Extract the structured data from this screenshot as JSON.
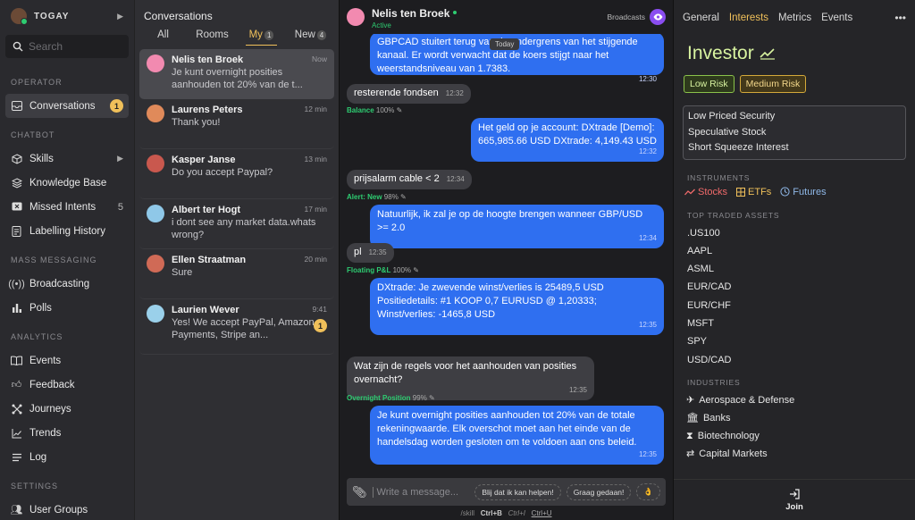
{
  "sidebar": {
    "brand": "TOGAY",
    "search_placeholder": "Search",
    "sections": {
      "operator": "OPERATOR",
      "chatbot": "CHATBOT",
      "mass": "MASS MESSAGING",
      "analytics": "ANALYTICS",
      "settings": "SETTINGS"
    },
    "items": {
      "conversations": {
        "label": "Conversations",
        "badge": "1"
      },
      "skills": {
        "label": "Skills"
      },
      "knowledge": {
        "label": "Knowledge Base"
      },
      "missed": {
        "label": "Missed Intents",
        "count": "5"
      },
      "labelling": {
        "label": "Labelling History"
      },
      "broadcasting": {
        "label": "Broadcasting"
      },
      "polls": {
        "label": "Polls"
      },
      "events": {
        "label": "Events"
      },
      "feedback": {
        "label": "Feedback"
      },
      "journeys": {
        "label": "Journeys"
      },
      "trends": {
        "label": "Trends"
      },
      "log": {
        "label": "Log"
      },
      "usergroups": {
        "label": "User Groups"
      }
    }
  },
  "conversations": {
    "title": "Conversations",
    "tabs": [
      {
        "label": "All"
      },
      {
        "label": "Rooms"
      },
      {
        "label": "My",
        "count": "1"
      },
      {
        "label": "New",
        "count": "4"
      }
    ],
    "list": [
      {
        "name": "Nelis ten Broek",
        "msg": "Je kunt overnight posities aanhouden tot 20% van de t...",
        "time": "Now"
      },
      {
        "name": "Laurens Peters",
        "msg": "Thank you!",
        "time": "12 min"
      },
      {
        "name": "Kasper Janse",
        "msg": "Do you accept Paypal?",
        "time": "13 min"
      },
      {
        "name": "Albert ter Hogt",
        "msg": "i dont see any market data.whats wrong?",
        "time": "17 min"
      },
      {
        "name": "Ellen Straatman",
        "msg": "Sure",
        "time": "20 min"
      },
      {
        "name": "Laurien Wever",
        "msg": "Yes! We accept PayPal, Amazon Payments, Stripe an...",
        "time": "9:41",
        "unread": "1"
      }
    ]
  },
  "chat": {
    "name": "Nelis ten Broek",
    "status": "Active",
    "broadcasts_label": "Broadcasts",
    "today": "Today",
    "messages": [
      {
        "text": "GBPCAD stuitert terug van de ondergrens van het stijgende kanaal. Er wordt verwacht dat de koers stijgt naar het weerstandsniveau van 1.7383.",
        "time": "12:30"
      },
      {
        "text": "resterende fondsen",
        "time": "12:32",
        "label": "Balance",
        "conf": "100%"
      },
      {
        "text": "Het geld op je account: DXtrade [Demo]: 665,985.66 USD DXtrade: 4,149.43 USD",
        "time": "12:32"
      },
      {
        "text": "prijsalarm cable < 2",
        "time": "12:34",
        "label": "Alert: New",
        "conf": "98%"
      },
      {
        "text": "Natuurlijk, ik zal je op de hoogte brengen wanneer GBP/USD >= 2.0",
        "time": "12:34"
      },
      {
        "text": "pl",
        "time": "12:35",
        "label": "Floating P&L",
        "conf": "100%"
      },
      {
        "text": "DXtrade: Je zwevende winst/verlies is 25489,5 USD Positiedetails: #1 KOOP 0,7 EURUSD @ 1,20333; Winst/verlies: -1465,8 USD",
        "time": "12:35"
      },
      {
        "text": "Wat zijn de regels voor het aanhouden van posities overnacht?",
        "time": "12:35",
        "label": "Overnight Position",
        "conf": "99%"
      },
      {
        "text": "Je kunt overnight posities aanhouden tot 20% van de totale rekeningwaarde. Elk overschot moet aan het einde van de handelsdag worden gesloten om te voldoen aan ons beleid.",
        "time": "12:35"
      }
    ],
    "composer": {
      "placeholder": "Write a message...",
      "chip1": "Blij dat ik kan helpen!",
      "chip2": "Graag gedaan!",
      "chip3": "👌"
    },
    "hints": {
      "skill": "/skill",
      "k1": "Ctrl+B",
      "k2": "Ctrl+I",
      "k3": "Ctrl+U"
    }
  },
  "panel": {
    "tabs": [
      "General",
      "Interests",
      "Metrics",
      "Events"
    ],
    "more": "•••",
    "profile": "Investor",
    "risks": [
      "Low Risk",
      "Medium Risk"
    ],
    "tags": [
      "Low Priced Security",
      "Speculative Stock",
      "Short Squeeze Interest"
    ],
    "instruments_title": "INSTRUMENTS",
    "instruments": [
      "Stocks",
      "ETFs",
      "Futures"
    ],
    "assets_title": "TOP TRADED ASSETS",
    "assets": [
      ".US100",
      "AAPL",
      "ASML",
      "EUR/CAD",
      "EUR/CHF",
      "MSFT",
      "SPY",
      "USD/CAD"
    ],
    "industries_title": "INDUSTRIES",
    "industries": [
      "Aerospace & Defense",
      "Banks",
      "Biotechnology",
      "Capital Markets"
    ],
    "join": "Join"
  },
  "colors": {
    "accent": "#f0c05a",
    "bubble_out": "#2f6ff0",
    "online": "#2ecc71"
  }
}
